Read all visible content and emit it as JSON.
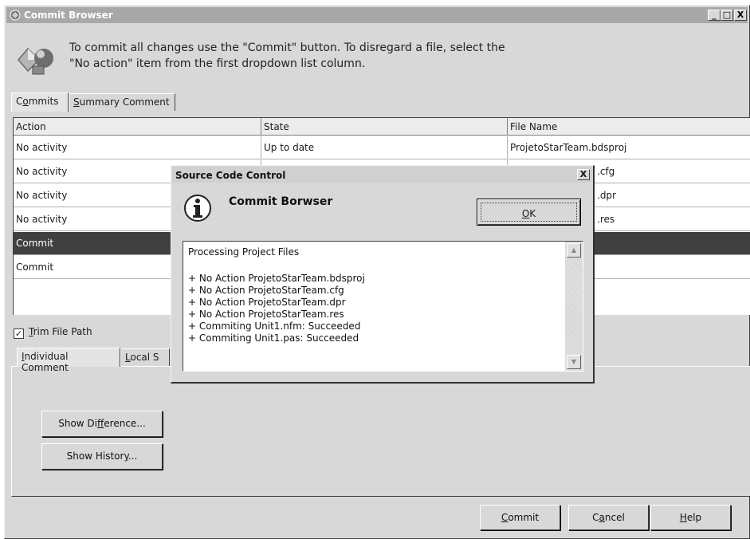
{
  "window": {
    "title": "Commit Browser",
    "controls": {
      "minimize": "_",
      "maximize": "□",
      "close": "X"
    }
  },
  "header": {
    "line1": "To commit all changes use the \"Commit\" button. To disregard a file, select the",
    "line2": "\"No action\" item from the first dropdown list column."
  },
  "top_tabs": [
    {
      "pre": "C",
      "u": "o",
      "post": "mmits"
    },
    {
      "pre": "",
      "u": "S",
      "post": "ummary Comment"
    }
  ],
  "grid": {
    "columns": [
      "Action",
      "State",
      "File Name"
    ],
    "rows": [
      {
        "action": "No activity",
        "state": "Up to date",
        "file": "ProjetoStarTeam.bdsproj"
      },
      {
        "action": "No activity",
        "state": "",
        "file": ".cfg"
      },
      {
        "action": "No activity",
        "state": "",
        "file": ".dpr"
      },
      {
        "action": "No activity",
        "state": "",
        "file": ".res"
      },
      {
        "action": "Commit",
        "state": "",
        "file": ""
      },
      {
        "action": "Commit",
        "state": "",
        "file": ""
      }
    ]
  },
  "trim": {
    "checked": "✓",
    "pre": "",
    "u": "T",
    "post": "rim File Path"
  },
  "bottom_tabs": [
    {
      "pre": "",
      "u": "I",
      "post": "ndividual Comment"
    },
    {
      "pre": "",
      "u": "L",
      "post": "ocal S"
    }
  ],
  "buttons": {
    "show_diff": {
      "pre": "Show Di",
      "u": "f",
      "post": "ference..."
    },
    "show_history": {
      "pre": "Show Histor",
      "u": "y",
      "post": "..."
    },
    "commit": {
      "pre": "",
      "u": "C",
      "post": "ommit"
    },
    "cancel": {
      "pre": "C",
      "u": "a",
      "post": "ncel"
    },
    "help": {
      "pre": "",
      "u": "H",
      "post": "elp"
    }
  },
  "dialog": {
    "title": "Source Code Control",
    "close": "X",
    "heading": "Commit Borwser",
    "ok": {
      "pre": "",
      "u": "O",
      "post": "K"
    },
    "log_header": "Processing Project Files",
    "log_lines": [
      "+ No Action ProjetoStarTeam.bdsproj",
      "+ No Action ProjetoStarTeam.cfg",
      "+ No Action ProjetoStarTeam.dpr",
      "+ No Action ProjetoStarTeam.res",
      "+ Commiting Unit1.nfm: Succeeded",
      "+ Commiting Unit1.pas: Succeeded"
    ],
    "scroll_up": "▲",
    "scroll_down": "▼"
  },
  "icons": {
    "app": "commit-browser-icon",
    "header": "commit-shapes-icon",
    "info": "info-icon"
  },
  "colors": {
    "window_bg": "#d8d8d8",
    "titlebar": "#a8a8a8",
    "selected_row": "#404040"
  }
}
